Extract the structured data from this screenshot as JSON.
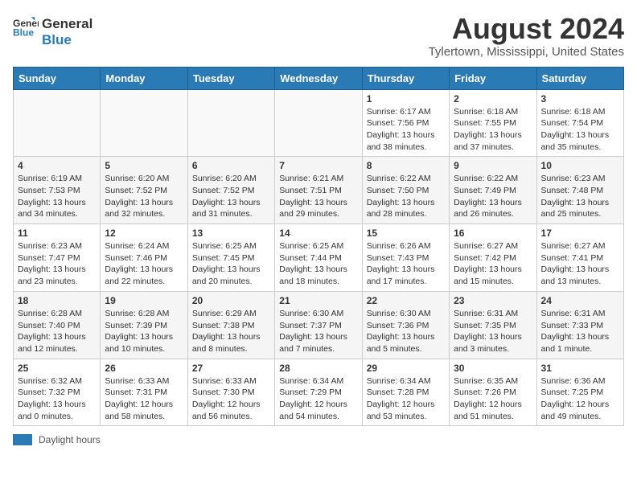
{
  "app": {
    "logo_line1": "General",
    "logo_line2": "Blue"
  },
  "header": {
    "month": "August 2024",
    "location": "Tylertown, Mississippi, United States"
  },
  "days_of_week": [
    "Sunday",
    "Monday",
    "Tuesday",
    "Wednesday",
    "Thursday",
    "Friday",
    "Saturday"
  ],
  "weeks": [
    [
      {
        "day": "",
        "info": ""
      },
      {
        "day": "",
        "info": ""
      },
      {
        "day": "",
        "info": ""
      },
      {
        "day": "",
        "info": ""
      },
      {
        "day": "1",
        "info": "Sunrise: 6:17 AM\nSunset: 7:56 PM\nDaylight: 13 hours and 38 minutes."
      },
      {
        "day": "2",
        "info": "Sunrise: 6:18 AM\nSunset: 7:55 PM\nDaylight: 13 hours and 37 minutes."
      },
      {
        "day": "3",
        "info": "Sunrise: 6:18 AM\nSunset: 7:54 PM\nDaylight: 13 hours and 35 minutes."
      }
    ],
    [
      {
        "day": "4",
        "info": "Sunrise: 6:19 AM\nSunset: 7:53 PM\nDaylight: 13 hours and 34 minutes."
      },
      {
        "day": "5",
        "info": "Sunrise: 6:20 AM\nSunset: 7:52 PM\nDaylight: 13 hours and 32 minutes."
      },
      {
        "day": "6",
        "info": "Sunrise: 6:20 AM\nSunset: 7:52 PM\nDaylight: 13 hours and 31 minutes."
      },
      {
        "day": "7",
        "info": "Sunrise: 6:21 AM\nSunset: 7:51 PM\nDaylight: 13 hours and 29 minutes."
      },
      {
        "day": "8",
        "info": "Sunrise: 6:22 AM\nSunset: 7:50 PM\nDaylight: 13 hours and 28 minutes."
      },
      {
        "day": "9",
        "info": "Sunrise: 6:22 AM\nSunset: 7:49 PM\nDaylight: 13 hours and 26 minutes."
      },
      {
        "day": "10",
        "info": "Sunrise: 6:23 AM\nSunset: 7:48 PM\nDaylight: 13 hours and 25 minutes."
      }
    ],
    [
      {
        "day": "11",
        "info": "Sunrise: 6:23 AM\nSunset: 7:47 PM\nDaylight: 13 hours and 23 minutes."
      },
      {
        "day": "12",
        "info": "Sunrise: 6:24 AM\nSunset: 7:46 PM\nDaylight: 13 hours and 22 minutes."
      },
      {
        "day": "13",
        "info": "Sunrise: 6:25 AM\nSunset: 7:45 PM\nDaylight: 13 hours and 20 minutes."
      },
      {
        "day": "14",
        "info": "Sunrise: 6:25 AM\nSunset: 7:44 PM\nDaylight: 13 hours and 18 minutes."
      },
      {
        "day": "15",
        "info": "Sunrise: 6:26 AM\nSunset: 7:43 PM\nDaylight: 13 hours and 17 minutes."
      },
      {
        "day": "16",
        "info": "Sunrise: 6:27 AM\nSunset: 7:42 PM\nDaylight: 13 hours and 15 minutes."
      },
      {
        "day": "17",
        "info": "Sunrise: 6:27 AM\nSunset: 7:41 PM\nDaylight: 13 hours and 13 minutes."
      }
    ],
    [
      {
        "day": "18",
        "info": "Sunrise: 6:28 AM\nSunset: 7:40 PM\nDaylight: 13 hours and 12 minutes."
      },
      {
        "day": "19",
        "info": "Sunrise: 6:28 AM\nSunset: 7:39 PM\nDaylight: 13 hours and 10 minutes."
      },
      {
        "day": "20",
        "info": "Sunrise: 6:29 AM\nSunset: 7:38 PM\nDaylight: 13 hours and 8 minutes."
      },
      {
        "day": "21",
        "info": "Sunrise: 6:30 AM\nSunset: 7:37 PM\nDaylight: 13 hours and 7 minutes."
      },
      {
        "day": "22",
        "info": "Sunrise: 6:30 AM\nSunset: 7:36 PM\nDaylight: 13 hours and 5 minutes."
      },
      {
        "day": "23",
        "info": "Sunrise: 6:31 AM\nSunset: 7:35 PM\nDaylight: 13 hours and 3 minutes."
      },
      {
        "day": "24",
        "info": "Sunrise: 6:31 AM\nSunset: 7:33 PM\nDaylight: 13 hours and 1 minute."
      }
    ],
    [
      {
        "day": "25",
        "info": "Sunrise: 6:32 AM\nSunset: 7:32 PM\nDaylight: 13 hours and 0 minutes."
      },
      {
        "day": "26",
        "info": "Sunrise: 6:33 AM\nSunset: 7:31 PM\nDaylight: 12 hours and 58 minutes."
      },
      {
        "day": "27",
        "info": "Sunrise: 6:33 AM\nSunset: 7:30 PM\nDaylight: 12 hours and 56 minutes."
      },
      {
        "day": "28",
        "info": "Sunrise: 6:34 AM\nSunset: 7:29 PM\nDaylight: 12 hours and 54 minutes."
      },
      {
        "day": "29",
        "info": "Sunrise: 6:34 AM\nSunset: 7:28 PM\nDaylight: 12 hours and 53 minutes."
      },
      {
        "day": "30",
        "info": "Sunrise: 6:35 AM\nSunset: 7:26 PM\nDaylight: 12 hours and 51 minutes."
      },
      {
        "day": "31",
        "info": "Sunrise: 6:36 AM\nSunset: 7:25 PM\nDaylight: 12 hours and 49 minutes."
      }
    ]
  ],
  "footer": {
    "label": "Daylight hours"
  }
}
